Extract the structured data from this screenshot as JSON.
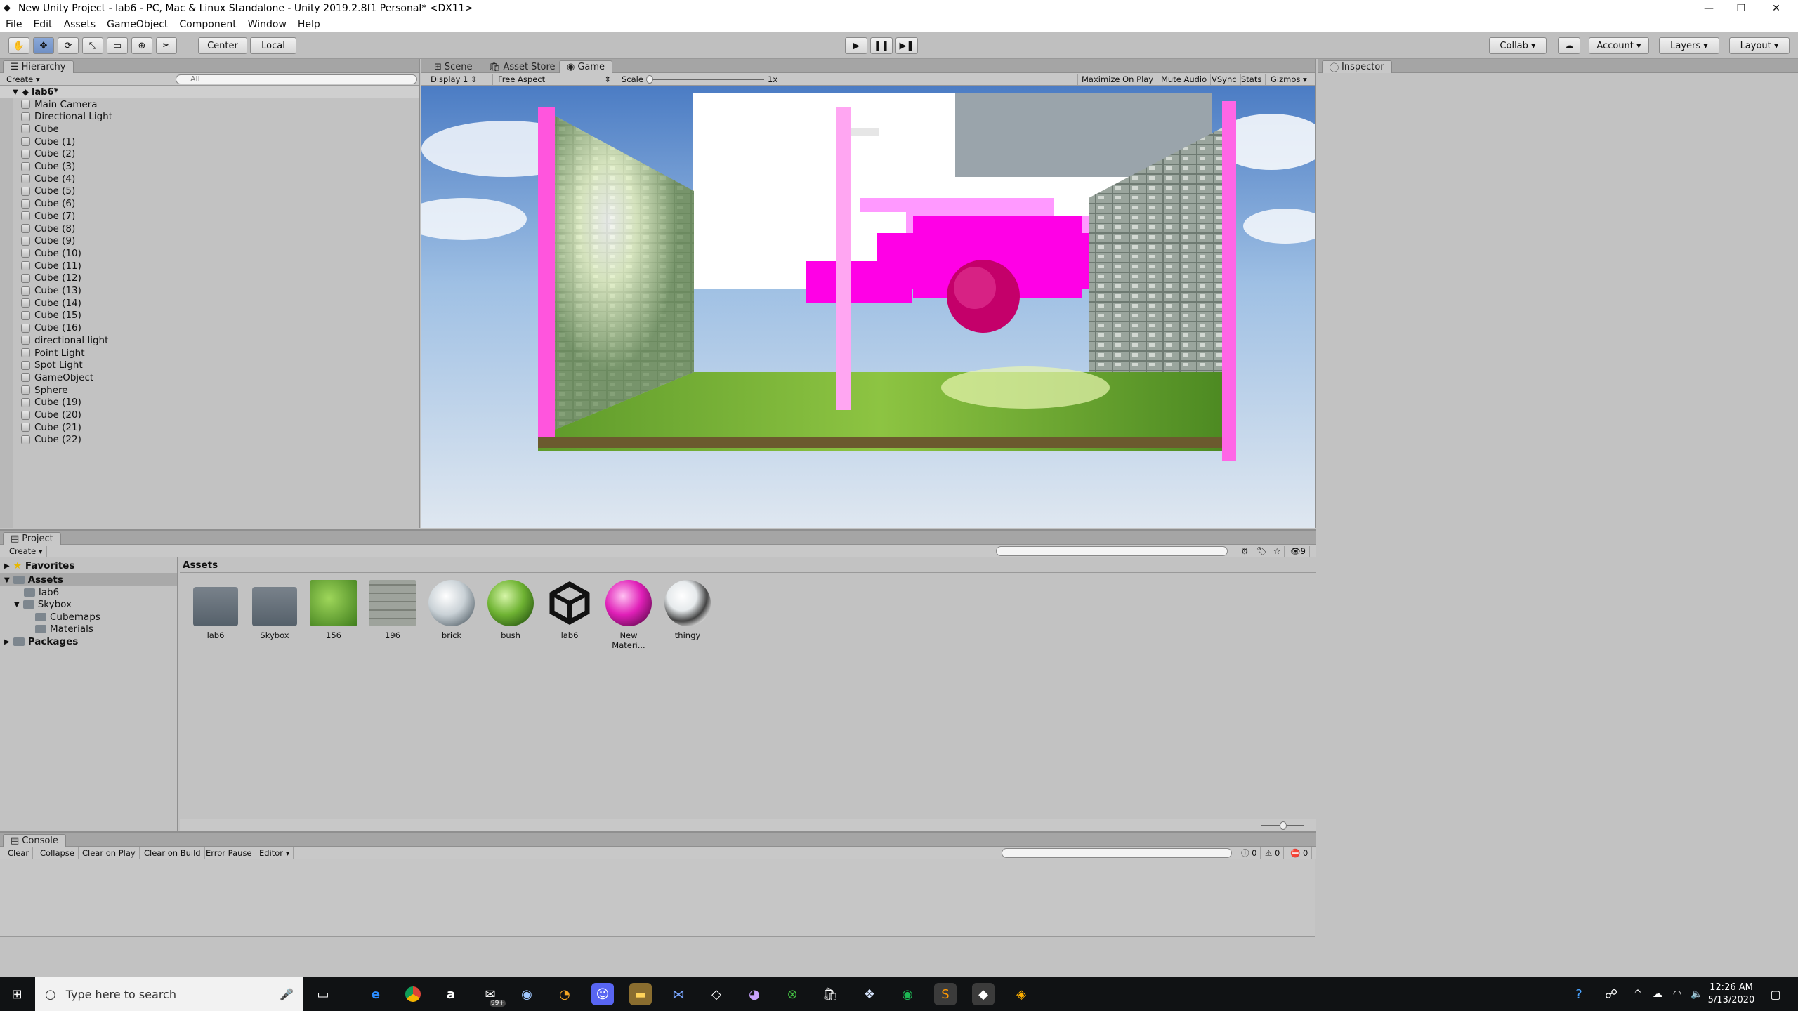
{
  "window": {
    "title": "New Unity Project - lab6 - PC, Mac & Linux Standalone - Unity 2019.2.8f1 Personal* <DX11>"
  },
  "menu": [
    "File",
    "Edit",
    "Assets",
    "GameObject",
    "Component",
    "Window",
    "Help"
  ],
  "toolbar": {
    "pivot": "Center",
    "space": "Local",
    "collab": "Collab",
    "account": "Account",
    "layers": "Layers",
    "layout": "Layout"
  },
  "hierarchy": {
    "tab": "Hierarchy",
    "create": "Create",
    "search_placeholder": "All",
    "scene": "lab6*",
    "items": [
      "Main Camera",
      "Directional Light",
      "Cube",
      "Cube (1)",
      "Cube (2)",
      "Cube (3)",
      "Cube (4)",
      "Cube (5)",
      "Cube (6)",
      "Cube (7)",
      "Cube (8)",
      "Cube (9)",
      "Cube (10)",
      "Cube (11)",
      "Cube (12)",
      "Cube (13)",
      "Cube (14)",
      "Cube (15)",
      "Cube (16)",
      "directional light",
      "Point Light",
      "Spot Light",
      "GameObject",
      "Sphere",
      "Cube (19)",
      "Cube (20)",
      "Cube (21)",
      "Cube (22)"
    ]
  },
  "game": {
    "tabs": [
      "Scene",
      "Asset Store",
      "Game"
    ],
    "display": "Display 1",
    "aspect": "Free Aspect",
    "scale_label": "Scale",
    "scale_value": "1x",
    "options": [
      "Maximize On Play",
      "Mute Audio",
      "VSync",
      "Stats",
      "Gizmos"
    ]
  },
  "inspector": {
    "tab": "Inspector"
  },
  "project": {
    "tab": "Project",
    "create": "Create",
    "favorites": "Favorites",
    "assets": "Assets",
    "lab6": "lab6",
    "skybox": "Skybox",
    "cubemaps": "Cubemaps",
    "materials": "Materials",
    "packages": "Packages",
    "breadcrumb": "Assets",
    "hidden_count": "9",
    "items": [
      {
        "label": "lab6",
        "kind": "folder"
      },
      {
        "label": "Skybox",
        "kind": "folder"
      },
      {
        "label": "156",
        "kind": "grass"
      },
      {
        "label": "196",
        "kind": "stone"
      },
      {
        "label": "brick",
        "kind": "sphere-white"
      },
      {
        "label": "bush",
        "kind": "sphere-green"
      },
      {
        "label": "lab6",
        "kind": "unity"
      },
      {
        "label": "New Materi...",
        "kind": "sphere-pink"
      },
      {
        "label": "thingy",
        "kind": "sphere-chrome"
      }
    ]
  },
  "console": {
    "tab": "Console",
    "buttons": [
      "Clear",
      "Collapse",
      "Clear on Play",
      "Clear on Build",
      "Error Pause",
      "Editor"
    ],
    "counts": [
      "0",
      "0",
      "0"
    ]
  },
  "taskbar": {
    "search_placeholder": "Type here to search",
    "badge": "99+",
    "time": "12:26 AM",
    "date": "5/13/2020"
  },
  "colors": {
    "accent": "#ff00ff",
    "panel": "#c2c2c2",
    "taskbar": "#101214"
  }
}
